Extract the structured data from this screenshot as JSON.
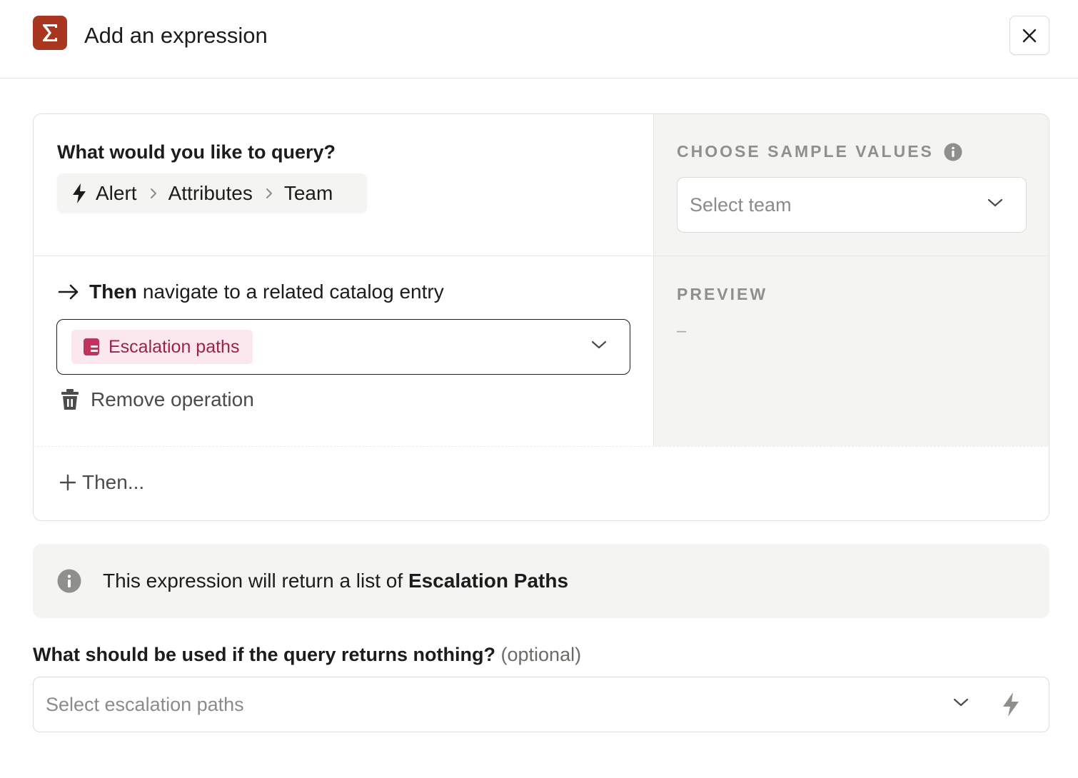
{
  "header": {
    "title": "Add an expression",
    "logo_icon": "sigma-icon",
    "close_icon": "close-icon"
  },
  "query": {
    "label": "What would you like to query?",
    "breadcrumb": [
      "Alert",
      "Attributes",
      "Team"
    ]
  },
  "operation": {
    "then_bold": "Then",
    "then_text": "navigate to a related catalog entry",
    "selected_value": "Escalation paths",
    "remove_label": "Remove operation"
  },
  "add_then": {
    "label": "Then..."
  },
  "sample": {
    "label": "CHOOSE SAMPLE VALUES",
    "placeholder": "Select team"
  },
  "preview": {
    "label": "PREVIEW",
    "value": "–"
  },
  "info": {
    "prefix": "This expression will return a list of",
    "bold": "Escalation Paths"
  },
  "fallback": {
    "label_bold": "What should be used if the query returns nothing?",
    "label_optional": "(optional)",
    "placeholder": "Select escalation paths"
  },
  "colors": {
    "brand": "#a9371f",
    "chip_bg": "#fbe8ee",
    "chip_text": "#9b2446",
    "panel_bg": "#f4f4f2"
  }
}
